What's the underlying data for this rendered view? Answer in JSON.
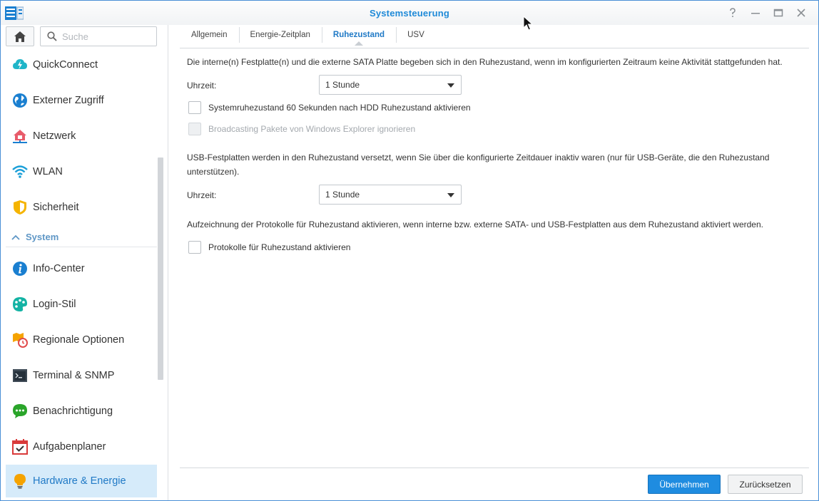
{
  "window": {
    "title": "Systemsteuerung",
    "accent_color": "#1f8ad8",
    "controls": [
      "help-icon",
      "minimize-icon",
      "maximize-icon",
      "close-icon"
    ]
  },
  "sidebar": {
    "search_placeholder": "Suche",
    "items": [
      {
        "label": "QuickConnect",
        "icon": "quickconnect-icon"
      },
      {
        "label": "Externer Zugriff",
        "icon": "globe-icon"
      },
      {
        "label": "Netzwerk",
        "icon": "network-house-icon"
      },
      {
        "label": "WLAN",
        "icon": "wifi-icon"
      },
      {
        "label": "Sicherheit",
        "icon": "shield-icon"
      }
    ],
    "section": {
      "label": "System",
      "icon": "chevron-up-icon"
    },
    "system_items": [
      {
        "label": "Info-Center",
        "icon": "info-icon"
      },
      {
        "label": "Login-Stil",
        "icon": "palette-icon"
      },
      {
        "label": "Regionale Optionen",
        "icon": "regional-clock-icon"
      },
      {
        "label": "Terminal & SNMP",
        "icon": "terminal-icon"
      },
      {
        "label": "Benachrichtigung",
        "icon": "chat-bubble-icon"
      },
      {
        "label": "Aufgabenplaner",
        "icon": "calendar-check-icon"
      },
      {
        "label": "Hardware & Energie",
        "icon": "lightbulb-icon",
        "active": true
      }
    ]
  },
  "tabs": [
    {
      "label": "Allgemein"
    },
    {
      "label": "Energie-Zeitplan"
    },
    {
      "label": "Ruhezustand",
      "active": true
    },
    {
      "label": "USV"
    }
  ],
  "main": {
    "internal_desc": "Die interne(n) Festplatte(n) und die externe SATA Platte begeben sich in den Ruhezustand, wenn im konfigurierten Zeitraum keine Aktivität stattgefunden hat.",
    "time_label_1": "Uhrzeit:",
    "time_value_1": "1 Stunde",
    "system_hibernation_label": "Systemruhezustand 60 Sekunden nach HDD Ruhezustand aktivieren",
    "system_hibernation_checked": false,
    "broadcast_label": "Broadcasting Pakete von Windows Explorer ignorieren",
    "broadcast_checked": false,
    "broadcast_disabled": true,
    "usb_desc": "USB-Festplatten werden in den Ruhezustand versetzt, wenn Sie über die konfigurierte Zeitdauer inaktiv waren (nur für USB-Geräte, die den Ruhezustand unterstützen).",
    "time_label_2": "Uhrzeit:",
    "time_value_2": "1 Stunde",
    "log_desc": "Aufzeichnung der Protokolle für Ruhezustand aktivieren, wenn interne bzw. externe SATA- und USB-Festplatten aus dem Ruhezustand aktiviert werden.",
    "log_label": "Protokolle für Ruhezustand aktivieren",
    "log_checked": false
  },
  "footer": {
    "apply_label": "Übernehmen",
    "reset_label": "Zurücksetzen"
  }
}
